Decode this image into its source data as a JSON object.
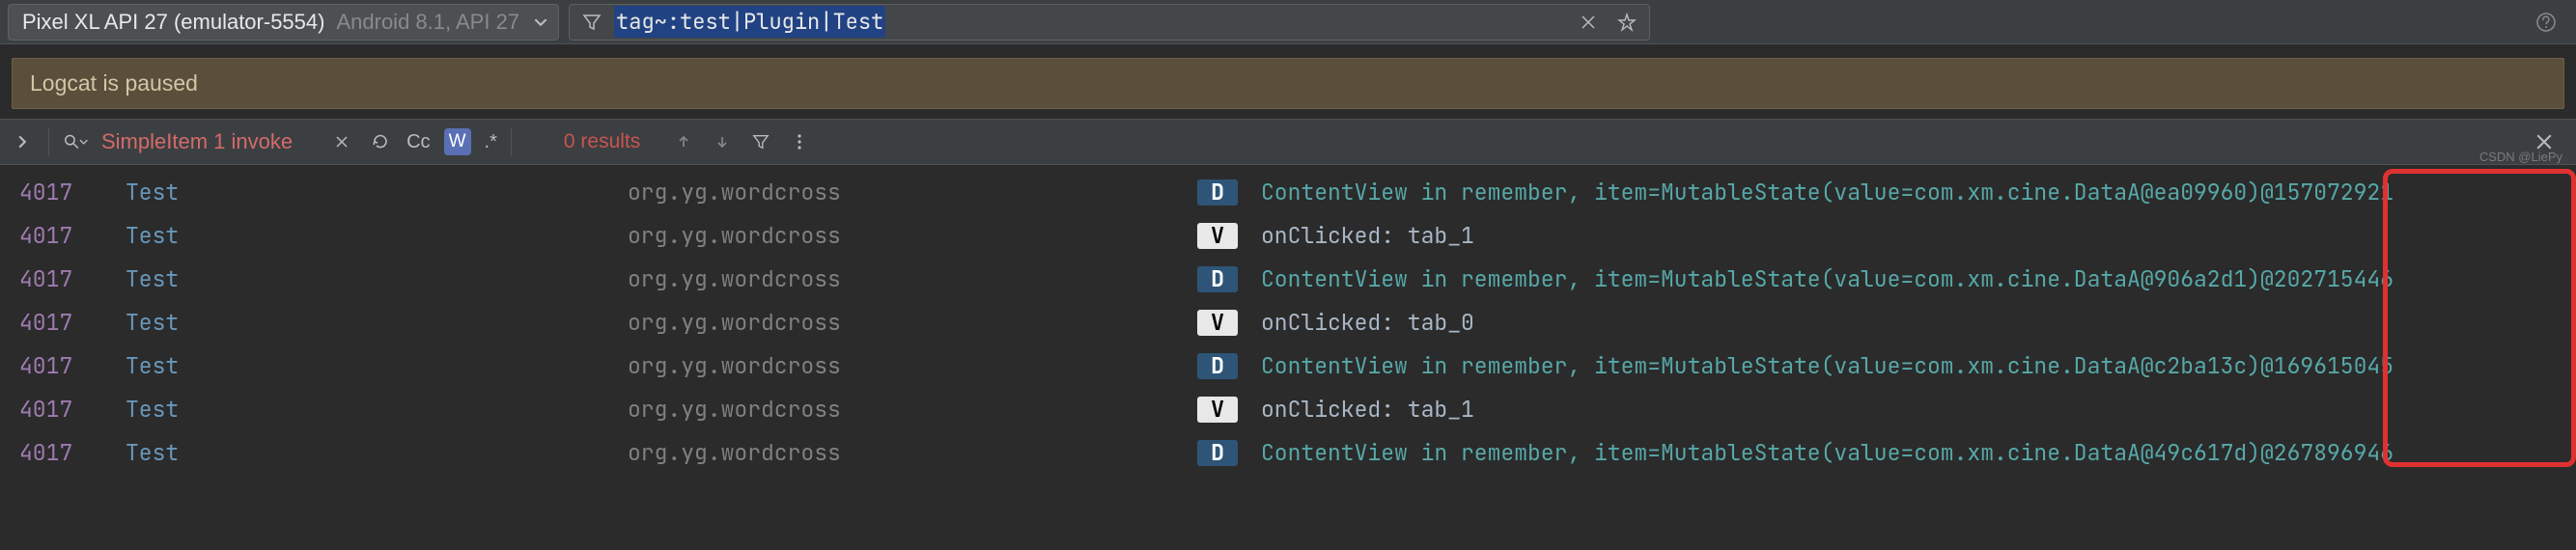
{
  "header": {
    "device_name": "Pixel XL API 27 (emulator-5554)",
    "device_meta": "Android 8.1, API 27",
    "filter_text": "tag~:test|Plugin|Test"
  },
  "banner": {
    "text": "Logcat is paused"
  },
  "find": {
    "query": "SimpleItem 1 invoke",
    "case_label": "Cc",
    "word_label": "W",
    "regex_label": ".*",
    "results_text": "0 results"
  },
  "log_cols": {
    "pid": "4017",
    "tag": "Test",
    "pkg": "org.yg.wordcross"
  },
  "logs": [
    {
      "lvl": "D",
      "msg": "ContentView in remember, item=MutableState(value=com.xm.cine.DataA@ea09960)@157072921"
    },
    {
      "lvl": "V",
      "msg": "onClicked: tab_1"
    },
    {
      "lvl": "D",
      "msg": "ContentView in remember, item=MutableState(value=com.xm.cine.DataA@906a2d1)@202715446"
    },
    {
      "lvl": "V",
      "msg": "onClicked: tab_0"
    },
    {
      "lvl": "D",
      "msg": "ContentView in remember, item=MutableState(value=com.xm.cine.DataA@c2ba13c)@169615045"
    },
    {
      "lvl": "V",
      "msg": "onClicked: tab_1"
    },
    {
      "lvl": "D",
      "msg": "ContentView in remember, item=MutableState(value=com.xm.cine.DataA@49c617d)@267896946"
    }
  ],
  "watermark": "CSDN @LiePy"
}
